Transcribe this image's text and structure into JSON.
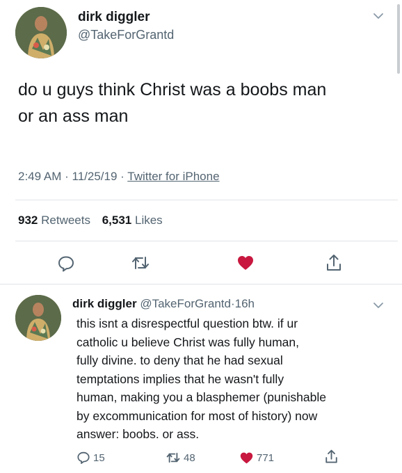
{
  "main_tweet": {
    "display_name": "dirk diggler",
    "handle": "@TakeForGrantd",
    "text_line1": "do u guys think Christ was a boobs man",
    "text_line2": "or an ass man",
    "time": "2:49 AM",
    "date": "11/25/19",
    "separator": "·",
    "source": "Twitter for iPhone",
    "retweets_count": "932",
    "retweets_label": "Retweets",
    "likes_count": "6,531",
    "likes_label": "Likes"
  },
  "reply_tweet": {
    "display_name": "dirk diggler",
    "handle": "@TakeForGrantd",
    "separator": "·",
    "age": "16h",
    "lines": [
      "this isnt a disrespectful question btw. if ur",
      "catholic u believe Christ was fully human,",
      "fully divine. to deny that he had sexual",
      "temptations implies that he wasn't fully",
      "human, making you a blasphemer (punishable",
      "by excommunication for most of history) now",
      "answer: boobs. or ass."
    ],
    "reply_count": "15",
    "retweet_count": "48",
    "like_count": "771"
  },
  "icons": {
    "reply": "reply-icon",
    "retweet": "retweet-icon",
    "like": "heart-icon",
    "share": "share-icon",
    "chevron": "chevron-down-icon"
  },
  "colors": {
    "text": "#14171a",
    "secondary": "#536471",
    "like": "#e0245e",
    "divider": "#dfe3e6"
  }
}
